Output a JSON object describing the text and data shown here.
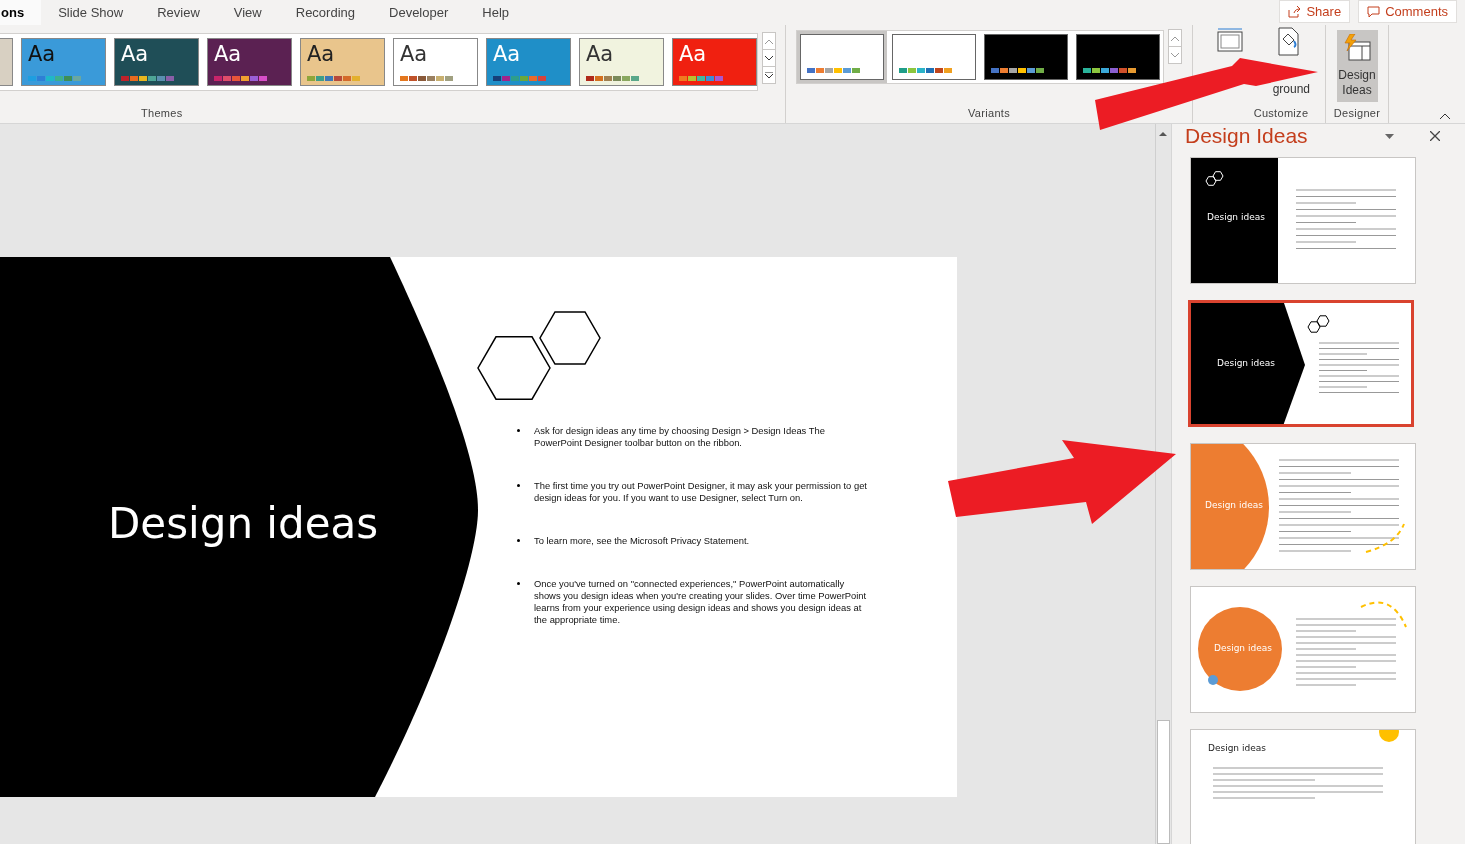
{
  "tabs": [
    {
      "label": "ons",
      "selected": true
    },
    {
      "label": "Slide Show",
      "selected": false
    },
    {
      "label": "Review",
      "selected": false
    },
    {
      "label": "View",
      "selected": false
    },
    {
      "label": "Recording",
      "selected": false
    },
    {
      "label": "Developer",
      "selected": false
    },
    {
      "label": "Help",
      "selected": false
    }
  ],
  "header_buttons": [
    {
      "label": "Share",
      "kind": "share"
    },
    {
      "label": "Comments",
      "kind": "comments"
    }
  ],
  "ribbon": {
    "themes": {
      "label": "Themes",
      "items": [
        {
          "color": "#d8d0c2"
        },
        {
          "color": "#3a9ad9",
          "sample": {
            "text": "Aa",
            "color": "#111111"
          },
          "swatches": [
            {
              "color": "#1e9ee0"
            },
            {
              "color": "#2e7fd6"
            },
            {
              "color": "#1fb8c8"
            },
            {
              "color": "#3db08d"
            },
            {
              "color": "#3e8e56"
            },
            {
              "color": "#6aa7a0"
            }
          ]
        },
        {
          "color": "#1f4e57",
          "sample": {
            "text": "Aa",
            "color": "#ffffff"
          },
          "swatches": [
            {
              "color": "#c0232b"
            },
            {
              "color": "#e86a1e"
            },
            {
              "color": "#e8b71e"
            },
            {
              "color": "#4da596"
            },
            {
              "color": "#5a8fb0"
            },
            {
              "color": "#8a5fa8"
            }
          ]
        },
        {
          "color": "#5b2152",
          "sample": {
            "text": "Aa",
            "color": "#ffffff"
          },
          "swatches": [
            {
              "color": "#c8246a"
            },
            {
              "color": "#e04c6a"
            },
            {
              "color": "#e8553a"
            },
            {
              "color": "#f0a030"
            },
            {
              "color": "#9a5fd6"
            },
            {
              "color": "#d84ec8"
            }
          ]
        },
        {
          "color": "#e9c58c",
          "sample": {
            "text": "Aa",
            "color": "#222222"
          },
          "swatches": [
            {
              "color": "#8ea63a"
            },
            {
              "color": "#3d9e8a"
            },
            {
              "color": "#3f77b5"
            },
            {
              "color": "#b84a3a"
            },
            {
              "color": "#d46a2a"
            },
            {
              "color": "#e3b02e"
            }
          ]
        },
        {
          "color": "#ffffff",
          "sample": {
            "text": "Aa",
            "color": "#333333"
          },
          "swatches": [
            {
              "color": "#e4771e"
            },
            {
              "color": "#c0522a"
            },
            {
              "color": "#8a5a3a"
            },
            {
              "color": "#9a8060"
            },
            {
              "color": "#c8b070"
            },
            {
              "color": "#a0a080"
            }
          ]
        },
        {
          "color": "#1f8fc8",
          "sample": {
            "text": "Aa",
            "color": "#ffffff"
          },
          "swatches": [
            {
              "color": "#173f78"
            },
            {
              "color": "#a3238a"
            },
            {
              "color": "#2e9e8a"
            },
            {
              "color": "#6aa83a"
            },
            {
              "color": "#e86a2a"
            },
            {
              "color": "#d8423a"
            }
          ]
        },
        {
          "color": "#f1f3df",
          "sample": {
            "text": "Aa",
            "color": "#333333"
          },
          "swatches": [
            {
              "color": "#b02a1a"
            },
            {
              "color": "#d4701e"
            },
            {
              "color": "#a08050"
            },
            {
              "color": "#7a8a5a"
            },
            {
              "color": "#8aa860"
            },
            {
              "color": "#5aa88a"
            }
          ]
        },
        {
          "color": "#f02010",
          "sample": {
            "text": "Aa",
            "color": "#ffffff"
          },
          "swatches": [
            {
              "color": "#f07a20"
            },
            {
              "color": "#b8c030"
            },
            {
              "color": "#40b8a0"
            },
            {
              "color": "#3a8ed8"
            },
            {
              "color": "#a858d0"
            }
          ]
        }
      ]
    },
    "variants": {
      "label": "Variants",
      "items": [
        {
          "selected": true,
          "color": "#ffffff",
          "swatches": [
            {
              "color": "#4472c4"
            },
            {
              "color": "#ed7d31"
            },
            {
              "color": "#a5a5a5"
            },
            {
              "color": "#ffc000"
            },
            {
              "color": "#5b9bd5"
            },
            {
              "color": "#70ad47"
            }
          ]
        },
        {
          "selected": false,
          "color": "#ffffff",
          "swatches": [
            {
              "color": "#1f9e89"
            },
            {
              "color": "#8cc63f"
            },
            {
              "color": "#2bb3c8"
            },
            {
              "color": "#1f6fb4"
            },
            {
              "color": "#c0461c"
            },
            {
              "color": "#f0a020"
            }
          ]
        },
        {
          "selected": false,
          "color": "#000000",
          "swatches": [
            {
              "color": "#4472c4"
            },
            {
              "color": "#ed7d31"
            },
            {
              "color": "#a5a5a5"
            },
            {
              "color": "#ffc000"
            },
            {
              "color": "#5b9bd5"
            },
            {
              "color": "#70ad47"
            }
          ]
        },
        {
          "selected": false,
          "color": "#000000",
          "swatches": [
            {
              "color": "#2ab39a"
            },
            {
              "color": "#8cc63f"
            },
            {
              "color": "#3aa8d8"
            },
            {
              "color": "#8a5fd0"
            },
            {
              "color": "#d0502a"
            },
            {
              "color": "#e89a30"
            }
          ]
        }
      ]
    },
    "customize": {
      "label": "Customize",
      "items": [
        {
          "kind": "slide-size"
        },
        {
          "kind": "format-background",
          "label": "ground"
        }
      ]
    },
    "designer": {
      "label": "Designer",
      "button": {
        "label": "Design Ideas",
        "selected": true
      }
    }
  },
  "slide": {
    "title": "Design ideas",
    "bullets": [
      "Ask for design ideas any time by choosing Design > Design Ideas  The PowerPoint Designer toolbar button on the ribbon.",
      "The first time you try out PowerPoint Designer, it may ask your permission to get design ideas for you. If you want to use Designer, select Turn on.",
      "To learn more, see the Microsoft Privacy Statement.",
      "Once you've turned on \"connected experiences,\" PowerPoint automatically shows you design ideas when you're creating your slides. Over time PowerPoint learns from your experience using design ideas and shows you design ideas at the appropriate time."
    ]
  },
  "design_pane": {
    "title": "Design Ideas",
    "ideas": [
      {
        "kind": "black-panel",
        "title": "Design ideas",
        "selected": false
      },
      {
        "kind": "black-chevron",
        "title": "Design ideas",
        "selected": true
      },
      {
        "kind": "orange-half-circle",
        "title": "Design ideas",
        "selected": false
      },
      {
        "kind": "orange-circle",
        "title": "Design ideas",
        "selected": false
      },
      {
        "kind": "title-top",
        "title": "Design ideas",
        "selected": false
      }
    ]
  }
}
